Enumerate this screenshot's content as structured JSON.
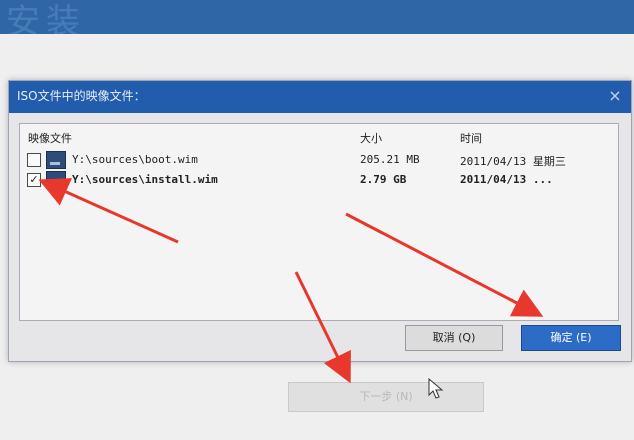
{
  "dialog": {
    "title": "ISO文件中的映像文件：",
    "close": "×"
  },
  "columns": {
    "name": "映像文件",
    "size": "大小",
    "time": "时间"
  },
  "files": [
    {
      "checked": "",
      "path": "Y:\\sources\\boot.wim",
      "size": "205.21 MB",
      "time": "2011/04/13 星期三"
    },
    {
      "checked": "✓",
      "path": "Y:\\sources\\install.wim",
      "size": "2.79 GB",
      "time": "2011/04/13 ..."
    }
  ],
  "buttons": {
    "cancel": "取消 (Q)",
    "ok": "确定 (E)",
    "next": "下一步 (N)"
  },
  "colors": {
    "titlebar": "#215cad",
    "ok_button": "#2c6bc6",
    "annotation_arrow": "#e8372c"
  }
}
